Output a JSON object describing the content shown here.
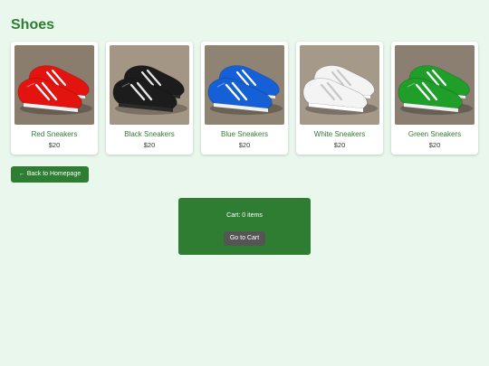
{
  "page": {
    "title": "Shoes"
  },
  "products": [
    {
      "name": "Red Sneakers",
      "price": "$20",
      "color": "#e3140f",
      "sole": "#f2f2f2",
      "accent": "#ffffff",
      "bg": "#8a7d6e"
    },
    {
      "name": "Black Sneakers",
      "price": "$20",
      "color": "#1c1c1c",
      "sole": "#2a2a2a",
      "accent": "#e8e8e8",
      "bg": "#a39684"
    },
    {
      "name": "Blue Sneakers",
      "price": "$20",
      "color": "#1560d6",
      "sole": "#f0f0f0",
      "accent": "#ffffff",
      "bg": "#8f8373"
    },
    {
      "name": "White Sneakers",
      "price": "$20",
      "color": "#f4f4f4",
      "sole": "#ffffff",
      "accent": "#c9c9c9",
      "bg": "#a5998a"
    },
    {
      "name": "Green Sneakers",
      "price": "$20",
      "color": "#1f9e2a",
      "sole": "#f0f0f0",
      "accent": "#ffffff",
      "bg": "#8a7f70"
    }
  ],
  "navigation": {
    "back_label": "← Back to Homepage"
  },
  "cart": {
    "count_text": "Cart: 0 items",
    "button_label": "Go to Cart"
  },
  "theme": {
    "accent": "#2e7d32",
    "background": "#e9f7ec"
  }
}
